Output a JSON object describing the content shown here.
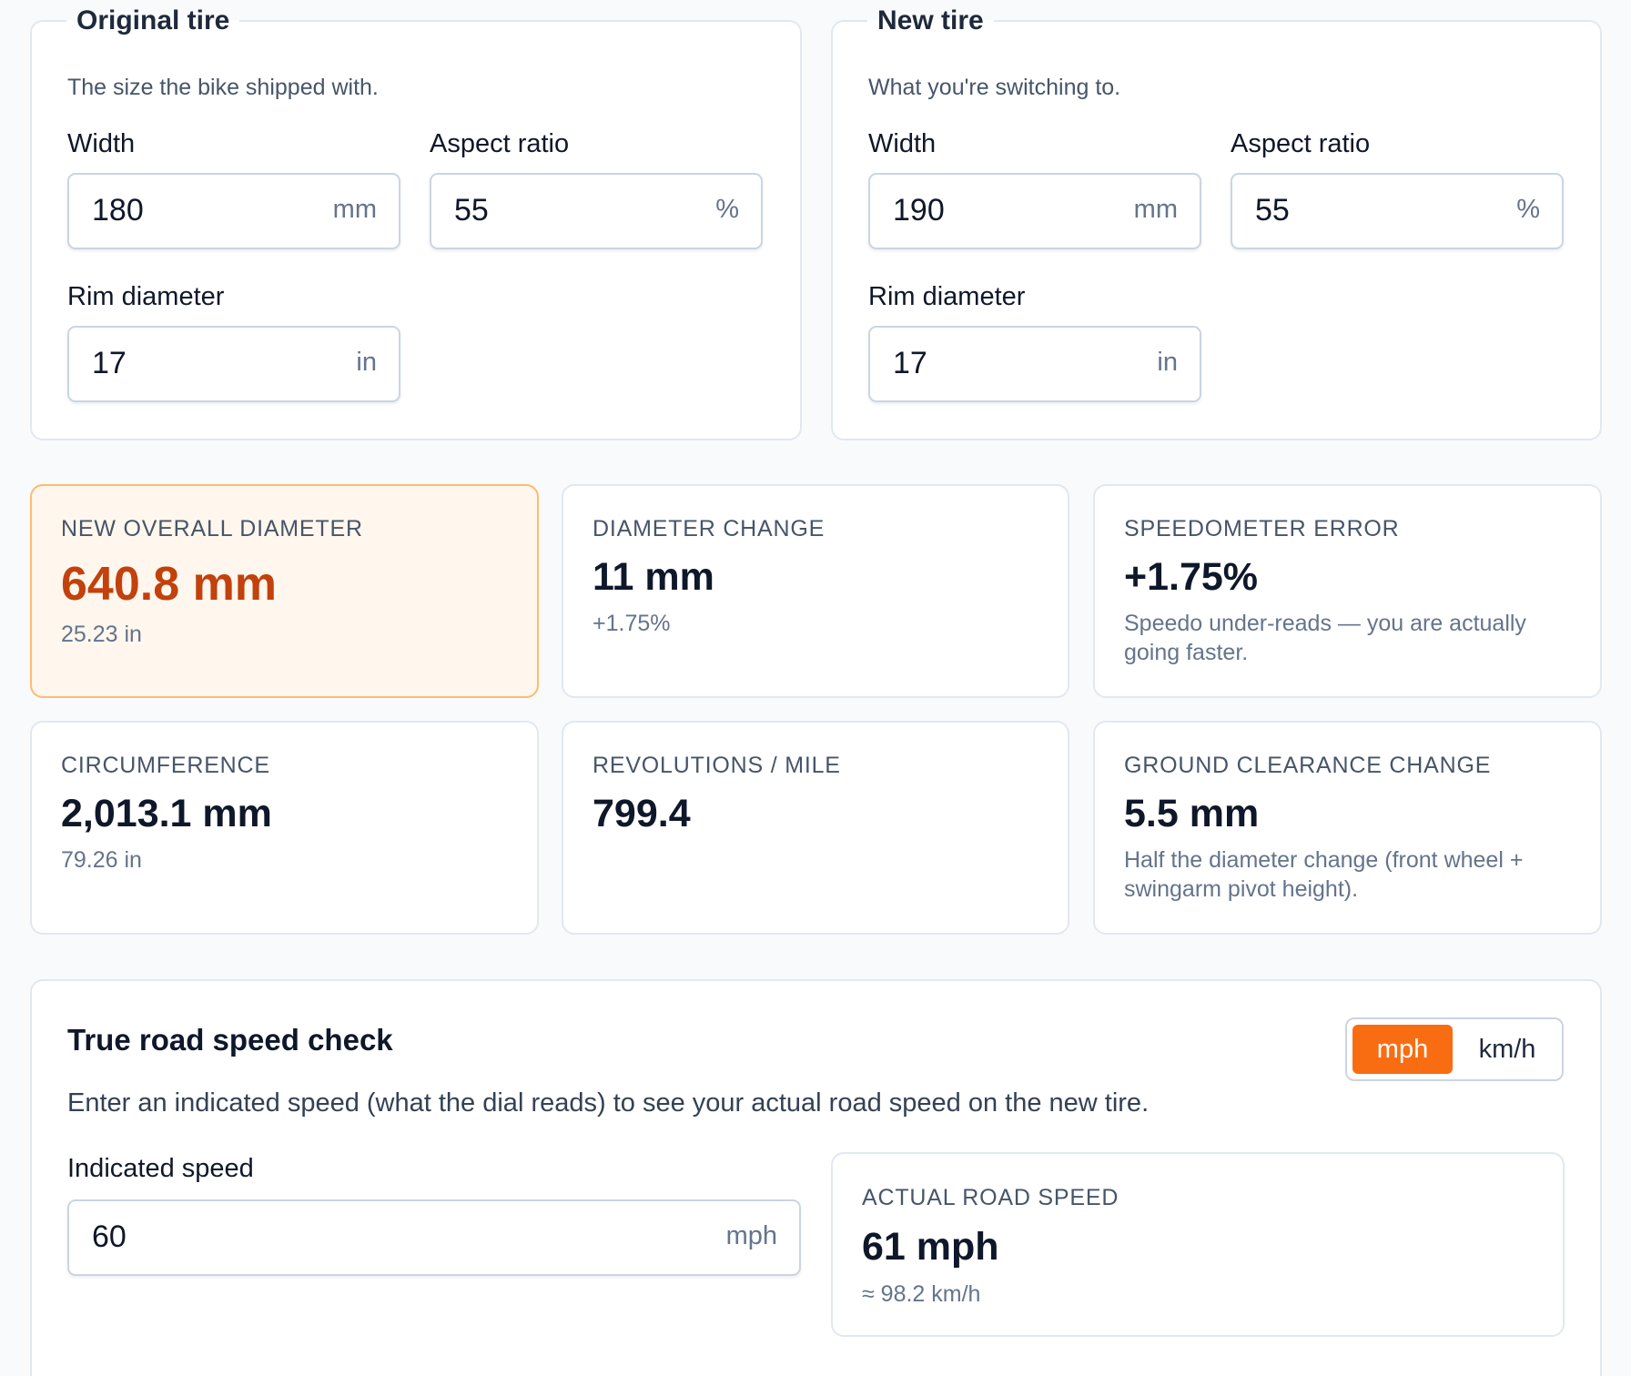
{
  "original": {
    "title": "Original tire",
    "desc": "The size the bike shipped with.",
    "width": {
      "label": "Width",
      "value": "180",
      "unit": "mm"
    },
    "aspect": {
      "label": "Aspect ratio",
      "value": "55",
      "unit": "%"
    },
    "rim": {
      "label": "Rim diameter",
      "value": "17",
      "unit": "in"
    }
  },
  "new_tire": {
    "title": "New tire",
    "desc": "What you're switching to.",
    "width": {
      "label": "Width",
      "value": "190",
      "unit": "mm"
    },
    "aspect": {
      "label": "Aspect ratio",
      "value": "55",
      "unit": "%"
    },
    "rim": {
      "label": "Rim diameter",
      "value": "17",
      "unit": "in"
    }
  },
  "stats": {
    "diameter": {
      "label": "NEW OVERALL DIAMETER",
      "value": "640.8 mm",
      "sub": "25.23 in"
    },
    "diameter_change": {
      "label": "DIAMETER CHANGE",
      "value": "11 mm",
      "sub": "+1.75%"
    },
    "speedo_error": {
      "label": "SPEEDOMETER ERROR",
      "value": "+1.75%",
      "sub": "Speedo under-reads — you are actually going faster."
    },
    "circumference": {
      "label": "CIRCUMFERENCE",
      "value": "2,013.1 mm",
      "sub": "79.26 in"
    },
    "revs": {
      "label": "REVOLUTIONS / MILE",
      "value": "799.4"
    },
    "clearance": {
      "label": "GROUND CLEARANCE CHANGE",
      "value": "5.5 mm",
      "sub": "Half the diameter change (front wheel + swingarm pivot height)."
    }
  },
  "speed_check": {
    "title": "True road speed check",
    "desc": "Enter an indicated speed (what the dial reads) to see your actual road speed on the new tire.",
    "toggle": {
      "mph": "mph",
      "kmh": "km/h",
      "selected": "mph"
    },
    "indicated": {
      "label": "Indicated speed",
      "value": "60",
      "unit": "mph"
    },
    "actual": {
      "label": "ACTUAL ROAD SPEED",
      "value": "61 mph",
      "sub": "≈ 98.2 km/h"
    }
  }
}
